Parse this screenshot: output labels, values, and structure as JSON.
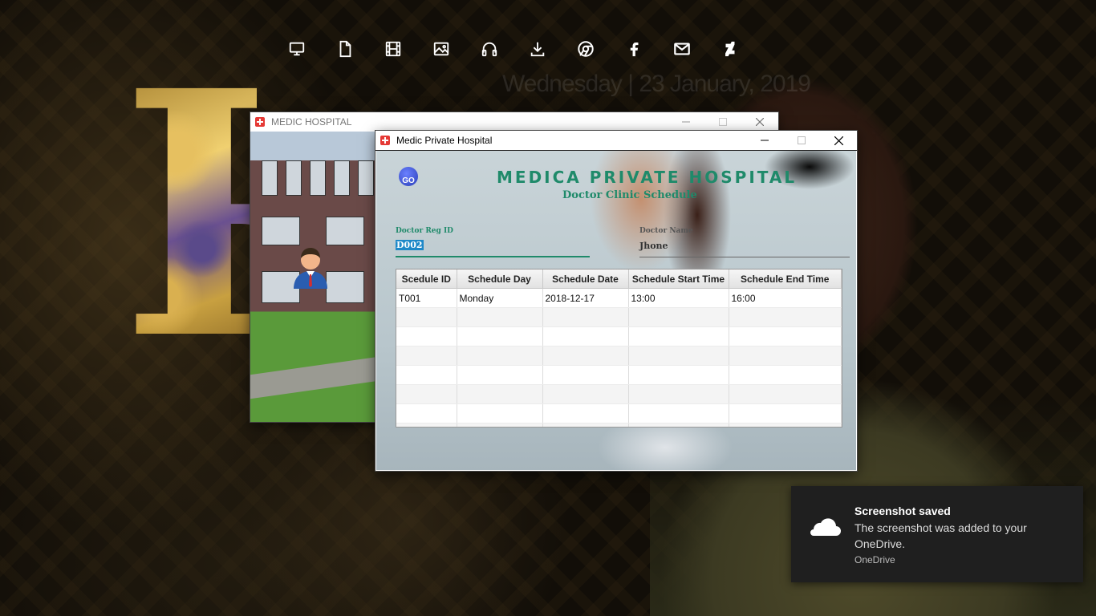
{
  "desktop": {
    "date_text": "Wednesday | 23 January, 2019"
  },
  "launcher": {
    "icons": [
      "monitor-icon",
      "document-icon",
      "film-icon",
      "image-icon",
      "headphones-icon",
      "download-icon",
      "chrome-icon",
      "facebook-icon",
      "mail-icon",
      "deviantart-icon"
    ]
  },
  "back_window": {
    "title": "MEDIC HOSPITAL"
  },
  "front_window": {
    "title": "Medic Private Hospital",
    "go_label": "GO",
    "heading": "MEDICA PRIVATE HOSPITAL",
    "subheading": "Doctor Clinic Schedule",
    "doctor_reg_id_label": "Doctor Reg ID",
    "doctor_reg_id_value": "D002",
    "doctor_name_label": "Doctor Name",
    "doctor_name_value": "Jhone",
    "table": {
      "columns": [
        "Scedule ID",
        "Schedule Day",
        "Schedule Date",
        "Schedule Start Time",
        "Schedule End Time"
      ],
      "rows": [
        [
          "T001",
          "Monday",
          "2018-12-17",
          "13:00",
          "16:00"
        ]
      ]
    }
  },
  "notification": {
    "title": "Screenshot saved",
    "body": "The screenshot was added to your OneDrive.",
    "source": "OneDrive"
  },
  "colors": {
    "accent_green": "#1f8a6a",
    "selection_blue": "#1e88c8",
    "toast_bg": "#1f1f1f"
  }
}
